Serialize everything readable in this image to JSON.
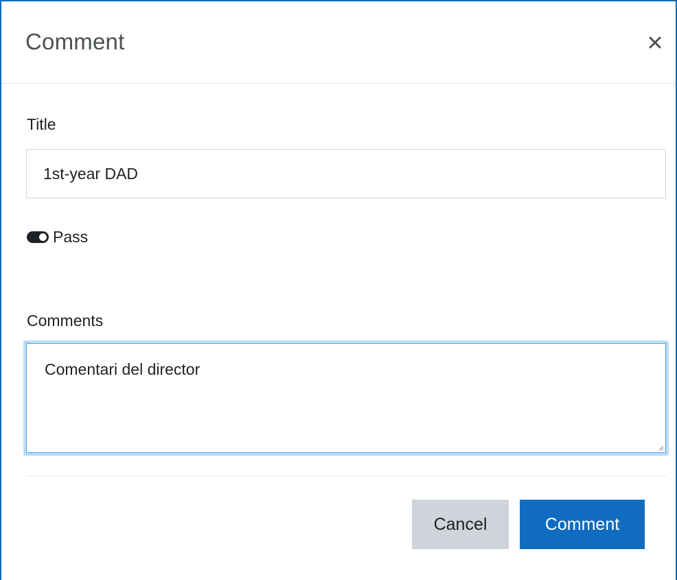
{
  "modal": {
    "title": "Comment",
    "close_icon": "close-icon"
  },
  "form": {
    "title_label": "Title",
    "title_value": "1st-year DAD",
    "pass_toggle": {
      "label": "Pass",
      "icon": "toggle-on-icon",
      "state": "on"
    },
    "comments_label": "Comments",
    "comments_value": "Comentari del director"
  },
  "footer": {
    "cancel_label": "Cancel",
    "submit_label": "Comment"
  },
  "colors": {
    "accent": "#0f6cbf",
    "secondary_button": "#ced4da",
    "focus_ring": "#bddcf5"
  }
}
